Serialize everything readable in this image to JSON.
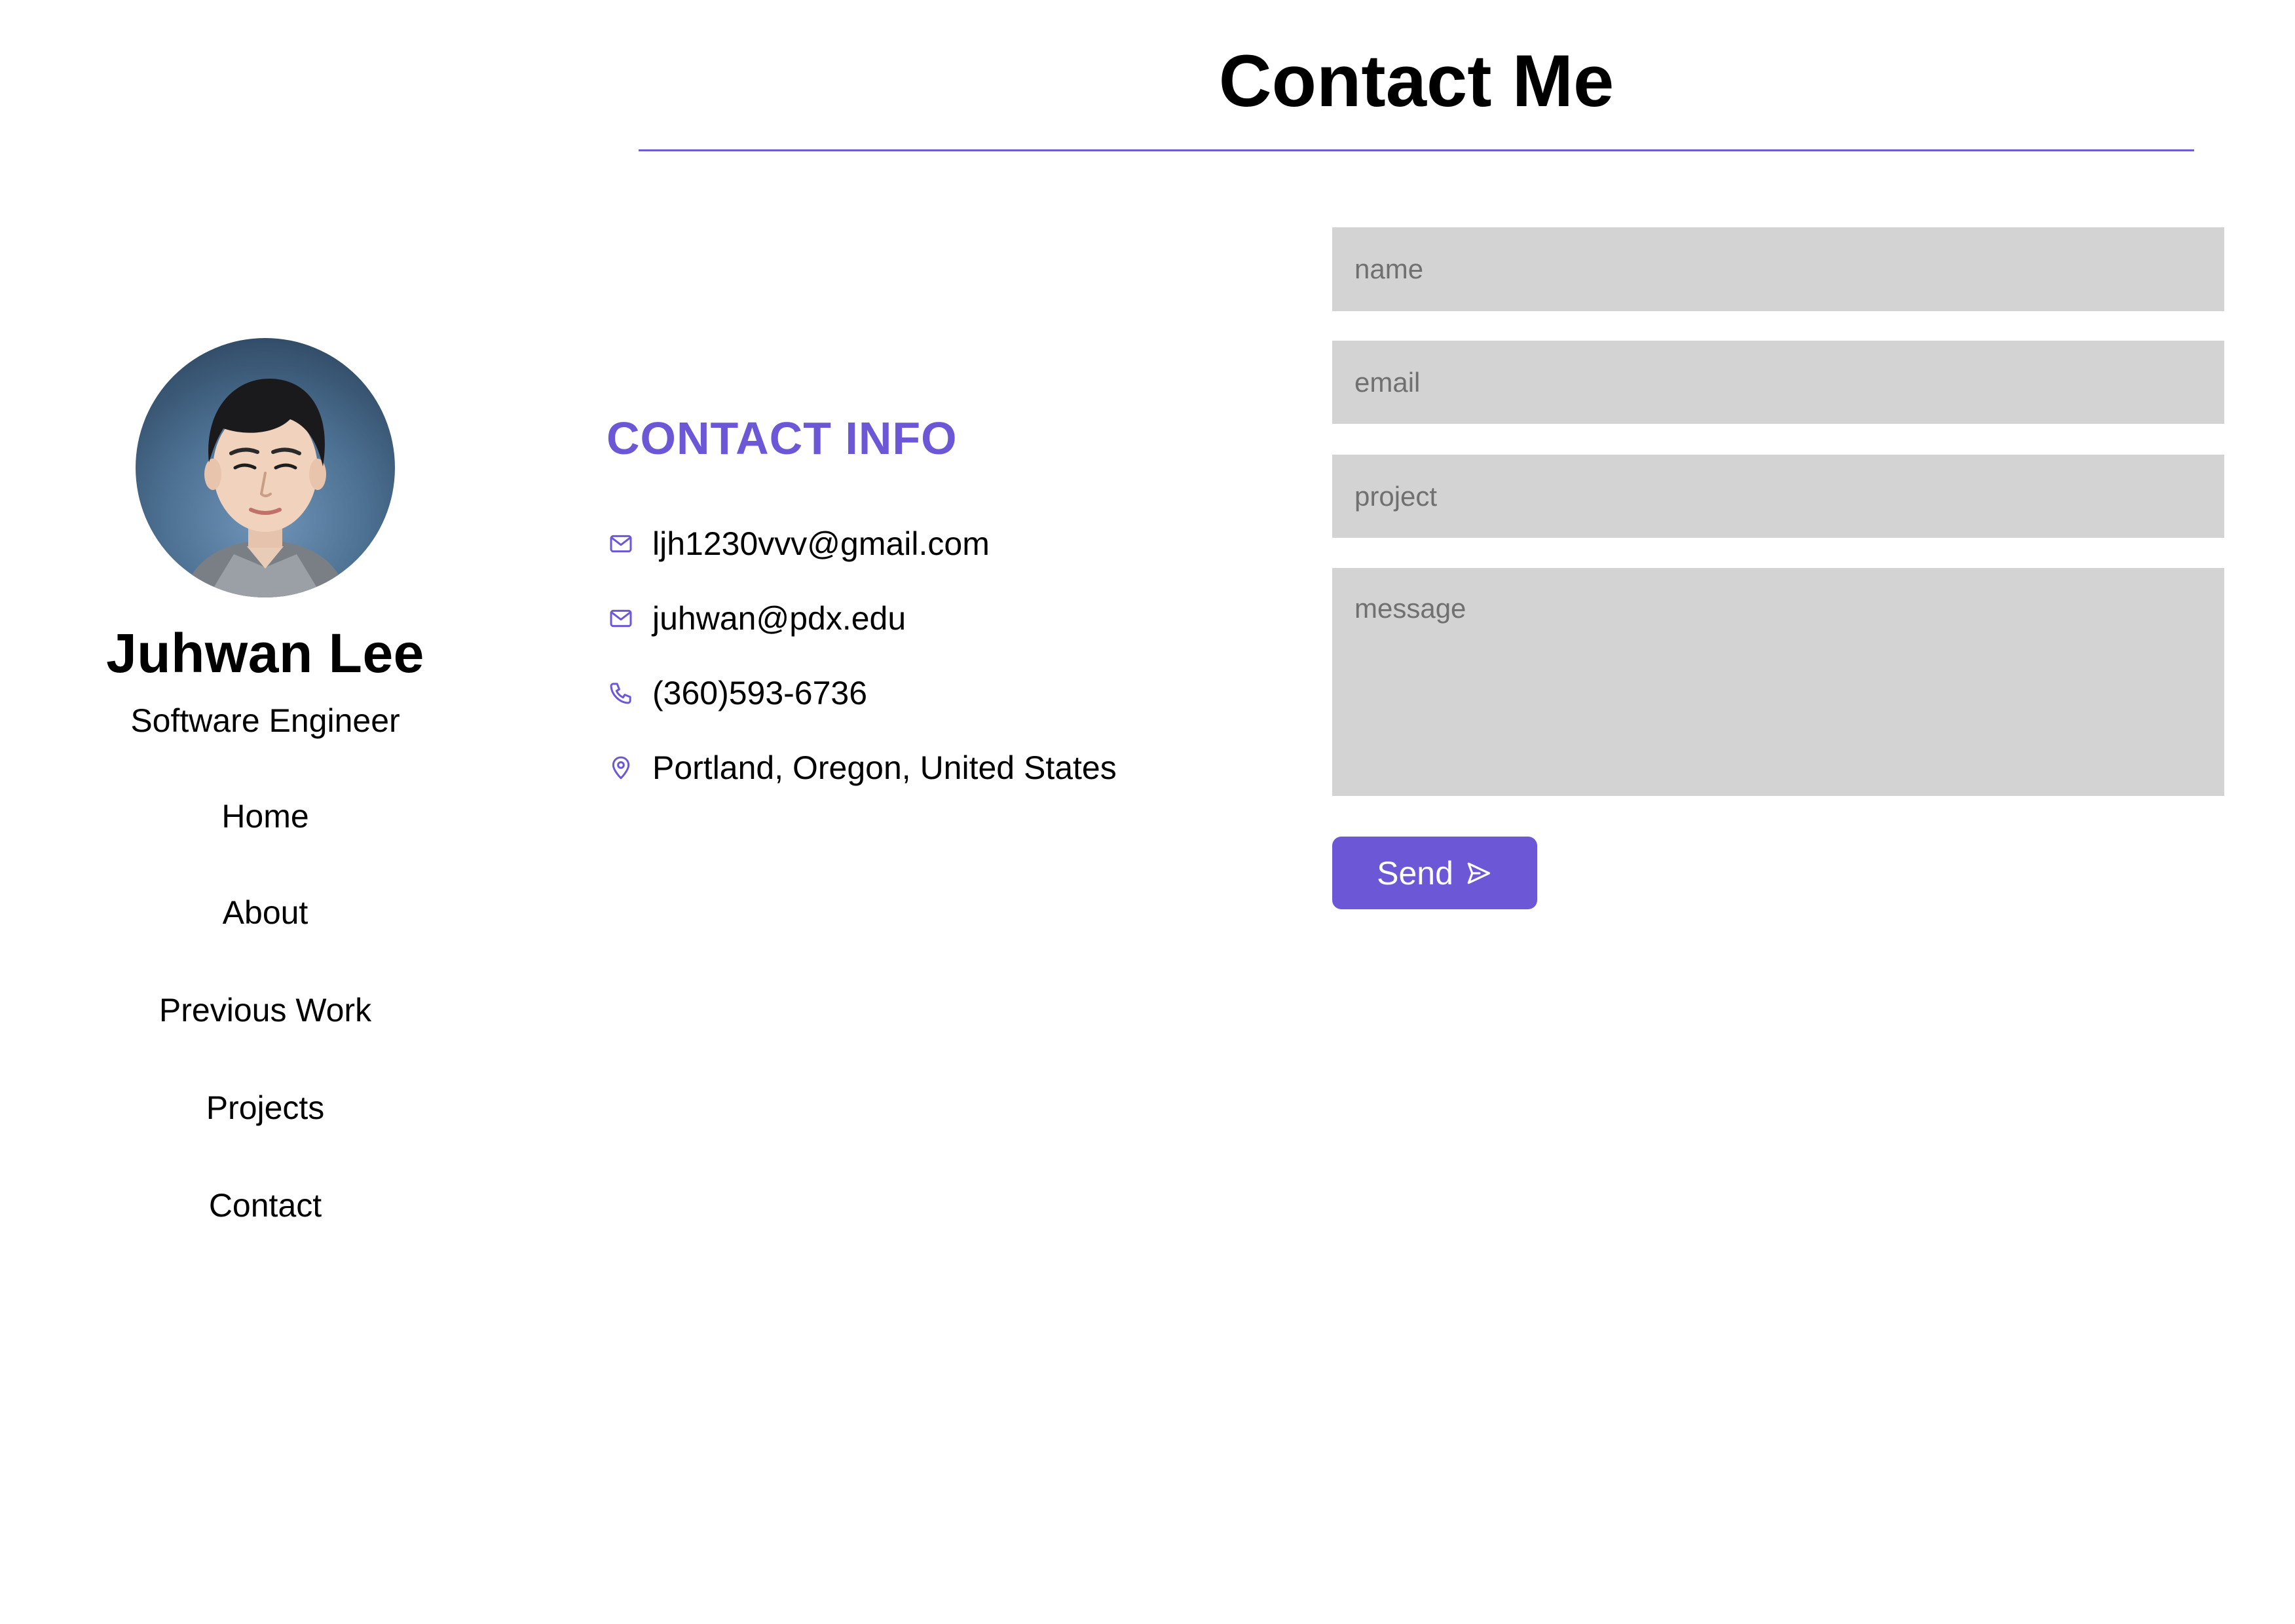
{
  "page": {
    "title": "Contact Me",
    "accent_color": "#6c57d6"
  },
  "sidebar": {
    "avatar_icon": "profile-photo",
    "name": "Juhwan Lee",
    "role": "Software Engineer",
    "nav": [
      {
        "label": "Home"
      },
      {
        "label": "About"
      },
      {
        "label": "Previous Work"
      },
      {
        "label": "Projects"
      },
      {
        "label": "Contact"
      }
    ]
  },
  "contact_info": {
    "heading": "CONTACT INFO",
    "items": [
      {
        "icon": "mail-icon",
        "text": "ljh1230vvv@gmail.com"
      },
      {
        "icon": "mail-icon",
        "text": "juhwan@pdx.edu"
      },
      {
        "icon": "phone-icon",
        "text": "(360)593-6736"
      },
      {
        "icon": "location-pin-icon",
        "text": "Portland, Oregon, United States"
      }
    ]
  },
  "form": {
    "name_placeholder": "name",
    "email_placeholder": "email",
    "project_placeholder": "project",
    "message_placeholder": "message",
    "field_color": "#d3d3d3",
    "send_label": "Send",
    "send_icon": "send-icon"
  }
}
